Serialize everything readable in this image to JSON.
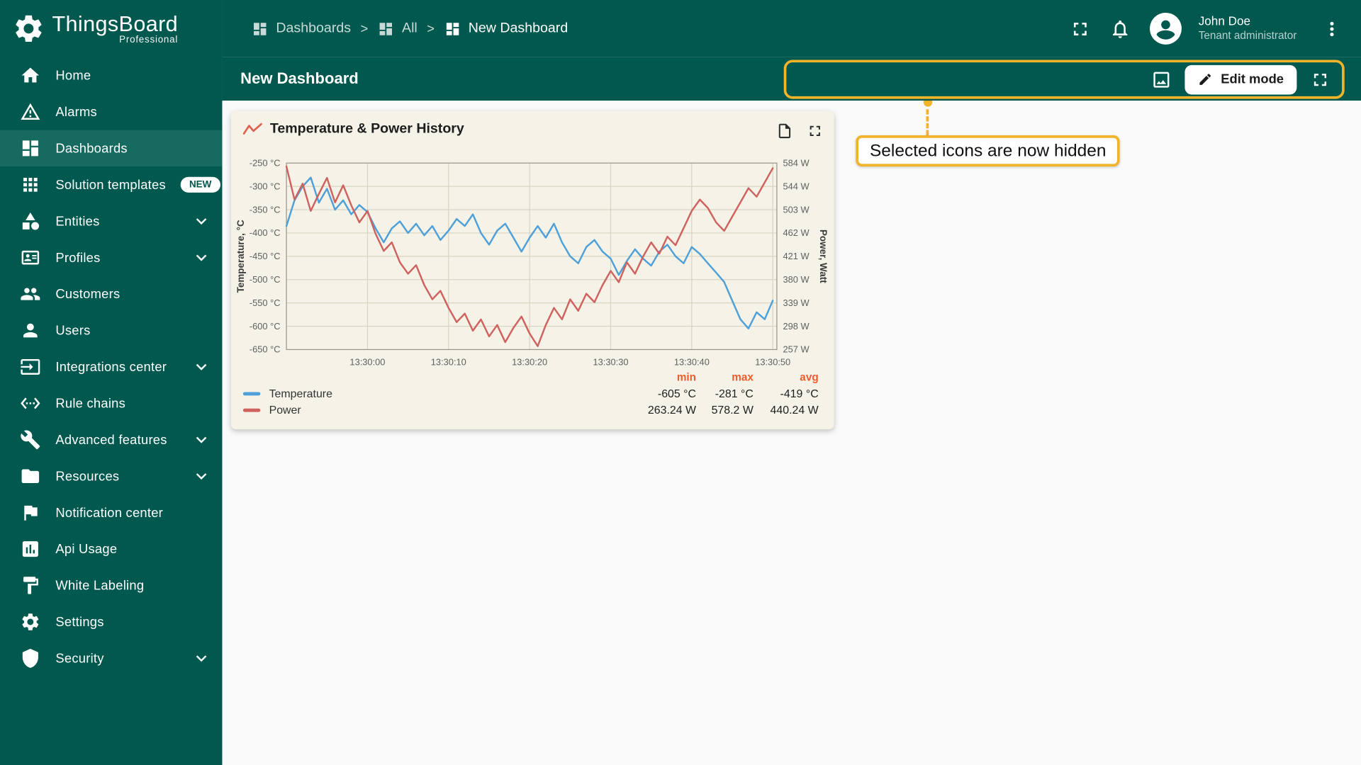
{
  "app": {
    "name": "ThingsBoard",
    "edition": "Professional"
  },
  "sidebar": {
    "items": [
      {
        "label": "Home"
      },
      {
        "label": "Alarms"
      },
      {
        "label": "Dashboards",
        "active": true
      },
      {
        "label": "Solution templates",
        "badge": "NEW"
      },
      {
        "label": "Entities",
        "expandable": true
      },
      {
        "label": "Profiles",
        "expandable": true
      },
      {
        "label": "Customers"
      },
      {
        "label": "Users"
      },
      {
        "label": "Integrations center",
        "expandable": true
      },
      {
        "label": "Rule chains"
      },
      {
        "label": "Advanced features",
        "expandable": true
      },
      {
        "label": "Resources",
        "expandable": true
      },
      {
        "label": "Notification center"
      },
      {
        "label": "Api Usage"
      },
      {
        "label": "White Labeling"
      },
      {
        "label": "Settings"
      },
      {
        "label": "Security",
        "expandable": true
      }
    ]
  },
  "header": {
    "breadcrumbs": [
      {
        "label": "Dashboards"
      },
      {
        "label": "All"
      },
      {
        "label": "New Dashboard"
      }
    ],
    "user": {
      "name": "John Doe",
      "role": "Tenant administrator"
    }
  },
  "toolbar": {
    "page_title": "New Dashboard",
    "edit_mode_label": "Edit mode"
  },
  "callout": {
    "text": "Selected icons are now hidden"
  },
  "widget": {
    "title": "Temperature & Power History",
    "legend": {
      "columns": [
        "min",
        "max",
        "avg"
      ],
      "rows": [
        {
          "name": "Temperature",
          "color": "#4f9fd8",
          "min": "-605 °C",
          "max": "-281 °C",
          "avg": "-419 °C"
        },
        {
          "name": "Power",
          "color": "#cf625f",
          "min": "263.24 W",
          "max": "578.2 W",
          "avg": "440.24 W"
        }
      ]
    }
  },
  "chart_data": {
    "type": "line",
    "title": "Temperature & Power History",
    "grid": true,
    "legend_position": "bottom",
    "x_axis": {
      "start": -10,
      "end": 50.5,
      "tick_seconds": [
        0,
        10,
        20,
        30,
        40,
        50
      ],
      "tick_labels": [
        "13:30:00",
        "13:30:10",
        "13:30:20",
        "13:30:30",
        "13:30:40",
        "13:30:50"
      ]
    },
    "left_axis": {
      "label": "Temperature, °C",
      "min": -650,
      "max": -250,
      "tick_labels": [
        "-250 °C",
        "-300 °C",
        "-350 °C",
        "-400 °C",
        "-450 °C",
        "-500 °C",
        "-550 °C",
        "-600 °C",
        "-650 °C"
      ]
    },
    "right_axis": {
      "label": "Power, Watt",
      "min": 257,
      "max": 584,
      "tick_labels": [
        "584 W",
        "544 W",
        "503 W",
        "462 W",
        "421 W",
        "380 W",
        "339 W",
        "298 W",
        "257 W"
      ]
    },
    "series": [
      {
        "name": "Temperature",
        "axis": "left",
        "color": "#4f9fd8",
        "x_start": -10,
        "x_step": 1,
        "values": [
          -385,
          -330,
          -300,
          -281,
          -335,
          -305,
          -350,
          -330,
          -360,
          -340,
          -355,
          -390,
          -420,
          -390,
          -375,
          -400,
          -380,
          -405,
          -385,
          -415,
          -395,
          -370,
          -385,
          -360,
          -400,
          -425,
          -395,
          -380,
          -410,
          -440,
          -410,
          -385,
          -410,
          -380,
          -420,
          -450,
          -465,
          -430,
          -415,
          -440,
          -455,
          -490,
          -460,
          -435,
          -455,
          -470,
          -440,
          -425,
          -450,
          -465,
          -430,
          -445,
          -465,
          -485,
          -505,
          -545,
          -585,
          -605,
          -570,
          -585,
          -545
        ]
      },
      {
        "name": "Power",
        "axis": "right",
        "color": "#cf625f",
        "x_start": -10,
        "x_step": 1,
        "values": [
          578,
          520,
          548,
          500,
          530,
          558,
          515,
          545,
          510,
          480,
          500,
          460,
          430,
          445,
          410,
          390,
          405,
          370,
          345,
          360,
          330,
          305,
          320,
          290,
          310,
          280,
          300,
          270,
          295,
          315,
          285,
          263,
          300,
          330,
          310,
          345,
          325,
          355,
          340,
          370,
          395,
          375,
          410,
          390,
          420,
          445,
          425,
          455,
          440,
          470,
          500,
          520,
          505,
          480,
          465,
          490,
          515,
          540,
          525,
          550,
          575
        ]
      }
    ],
    "stats": {
      "temperature": {
        "min": "-605 °C",
        "max": "-281 °C",
        "avg": "-419 °C"
      },
      "power": {
        "min": "263.24 W",
        "max": "578.2 W",
        "avg": "440.24 W"
      }
    }
  },
  "colors": {
    "primary": "#00584e",
    "sidebar_active": "#176a5f",
    "highlight": "#f0b32a",
    "card_background": "#f5f3e7",
    "temperature_series": "#4f9fd8",
    "power_series": "#cf625f",
    "legend_header": "#ee5c2d"
  }
}
